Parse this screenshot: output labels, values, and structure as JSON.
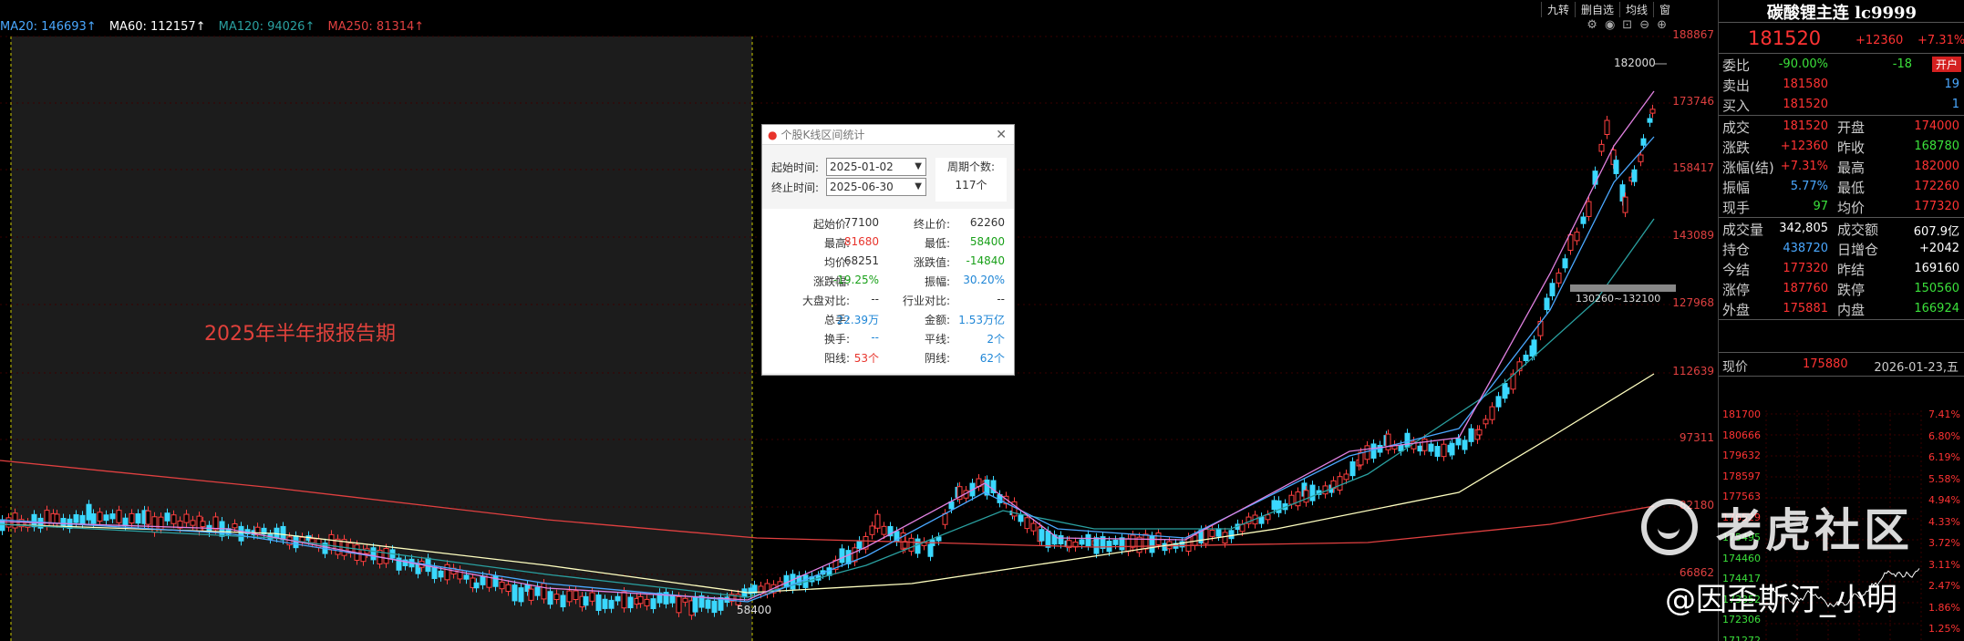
{
  "legend": {
    "ma20": "MA20: 146693↑",
    "ma60": "MA60: 112157↑",
    "ma120": "MA120: 94026↑",
    "ma250": "MA250: 81314↑"
  },
  "toolbar": {
    "items": [
      "九转",
      "删自选",
      "均线",
      "窗"
    ]
  },
  "chart": {
    "period_label": "2025年半年报报告期",
    "high_annotation": "182000",
    "low_annotation": "58400",
    "range_annotation": "130260~132100",
    "y_ticks": [
      "188867",
      "173746",
      "158417",
      "143089",
      "127968",
      "112639",
      "97311",
      "82180",
      "66862"
    ]
  },
  "popup": {
    "title": "个股K线区间统计",
    "start_label": "起始时间:",
    "start_value": "2025-01-02",
    "end_label": "终止时间:",
    "end_value": "2025-06-30",
    "period_label": "周期个数:",
    "period_value": "117个",
    "rows": [
      {
        "l1": "起始价:",
        "v1": "77100",
        "c1": "c-dark",
        "l2": "终止价:",
        "v2": "62260",
        "c2": "c-dark"
      },
      {
        "l1": "最高:",
        "v1": "81680",
        "c1": "c-red",
        "l2": "最低:",
        "v2": "58400",
        "c2": "c-green"
      },
      {
        "l1": "均价:",
        "v1": "68251",
        "c1": "c-dark",
        "l2": "涨跌值:",
        "v2": "-14840",
        "c2": "c-green"
      },
      {
        "l1": "涨跌幅:",
        "v1": "-19.25%",
        "c1": "c-green",
        "l2": "振幅:",
        "v2": "30.20%",
        "c2": "c-blue"
      },
      {
        "l1": "大盘对比:",
        "v1": "--",
        "c1": "c-dark",
        "l2": "行业对比:",
        "v2": "--",
        "c2": "c-dark"
      },
      {
        "l1": "总手:",
        "v1": "22.39万",
        "c1": "c-blue",
        "l2": "金额:",
        "v2": "1.53万亿",
        "c2": "c-blue"
      },
      {
        "l1": "换手:",
        "v1": "--",
        "c1": "c-blue",
        "l2": "平线:",
        "v2": "2个",
        "c2": "c-blue"
      },
      {
        "l1": "阳线:",
        "v1": "53个",
        "c1": "c-red",
        "l2": "阴线:",
        "v2": "62个",
        "c2": "c-blue"
      }
    ]
  },
  "quote": {
    "title": "碳酸锂主连 lc9999",
    "price": "181520",
    "change": "+12360",
    "pct": "+7.31%",
    "rows": [
      {
        "a": "委比",
        "b": "-90.00%",
        "bc": "#3be03b",
        "c": "",
        "d": "-18",
        "dc": "#3be03b",
        "badge": "开户"
      },
      {
        "a": "卖出",
        "b": "181580",
        "bc": "#ff3333",
        "c": "",
        "d": "19",
        "dc": "#4aa8ff"
      },
      {
        "a": "买入",
        "b": "181520",
        "bc": "#ff3333",
        "c": "",
        "d": "1",
        "dc": "#4aa8ff"
      },
      {
        "a": "成交",
        "b": "181520",
        "bc": "#ff3333",
        "c": "开盘",
        "d": "174000",
        "dc": "#ff3333"
      },
      {
        "a": "涨跌",
        "b": "+12360",
        "bc": "#ff3333",
        "c": "昨收",
        "d": "168780",
        "dc": "#3be03b"
      },
      {
        "a": "涨幅(结)",
        "b": "+7.31%",
        "bc": "#ff3333",
        "c": "最高",
        "d": "182000",
        "dc": "#ff3333"
      },
      {
        "a": "振幅",
        "b": "5.77%",
        "bc": "#4aa8ff",
        "c": "最低",
        "d": "172260",
        "dc": "#ff3333"
      },
      {
        "a": "现手",
        "b": "97",
        "bc": "#3be03b",
        "c": "均价",
        "d": "177320",
        "dc": "#ff3333"
      },
      {
        "a": "成交量",
        "b": "342,805",
        "bc": "#ffffff",
        "c": "成交额",
        "d": "607.9亿",
        "dc": "#ffffff"
      },
      {
        "a": "持仓",
        "b": "438720",
        "bc": "#4aa8ff",
        "c": "日增仓",
        "d": "+2042",
        "dc": "#ffffff"
      },
      {
        "a": "今结",
        "b": "177320",
        "bc": "#ff3333",
        "c": "昨结",
        "d": "169160",
        "dc": "#ffffff"
      },
      {
        "a": "涨停",
        "b": "187760",
        "bc": "#ff3333",
        "c": "跌停",
        "d": "150560",
        "dc": "#3be03b"
      },
      {
        "a": "外盘",
        "b": "175881",
        "bc": "#ff3333",
        "c": "内盘",
        "d": "166924",
        "dc": "#3be03b"
      }
    ],
    "spot_label": "现价",
    "spot_value": "175880",
    "spot_date": "2026-01-23,五",
    "mini_left_ticks": [
      "181700",
      "180666",
      "179632",
      "178597",
      "177563",
      "176529",
      "175495",
      "174460",
      "174417",
      "173352",
      "172306",
      "171272"
    ],
    "mini_right_ticks": [
      "7.41%",
      "6.80%",
      "6.19%",
      "5.58%",
      "4.94%",
      "4.33%",
      "3.72%",
      "3.11%",
      "2.47%",
      "1.86%",
      "1.25%"
    ]
  },
  "watermark": {
    "brand": "老虎社区",
    "user": "@因歪斯汀_小明"
  }
}
